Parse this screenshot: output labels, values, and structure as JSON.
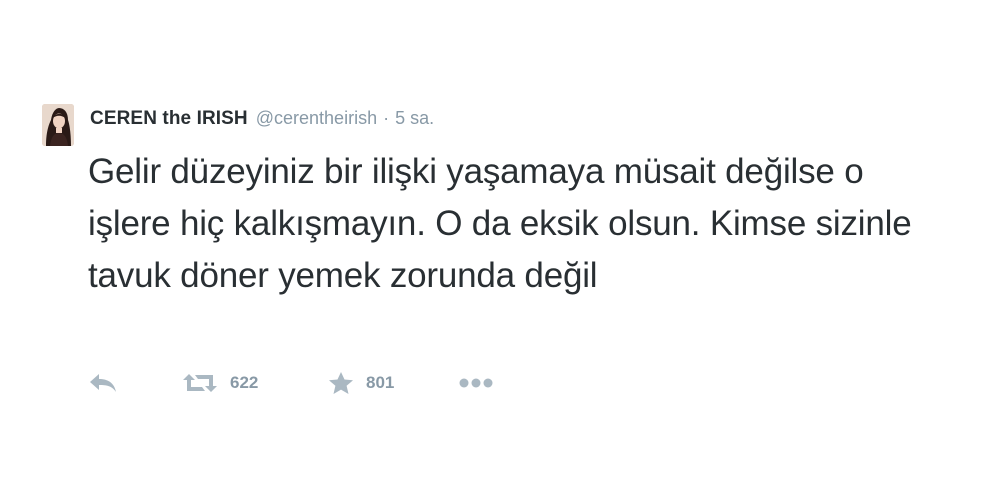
{
  "tweet": {
    "author": {
      "display_name": "CEREN the IRISH",
      "handle": "@cerentheirish",
      "avatar_icon": "profile-photo"
    },
    "separator": "·",
    "timestamp": "5 sa.",
    "text": "Gelir düzeyiniz bir ilişki yaşamaya müsait değilse o işlere hiç kalkışmayın. O da eksik olsun. Kimse sizinle tavuk döner yemek zorunda değil",
    "actions": {
      "reply_icon": "reply-icon",
      "retweet_icon": "retweet-icon",
      "retweet_count": "622",
      "favorite_icon": "star-icon",
      "favorite_count": "801",
      "more_icon": "more-dots-icon"
    }
  },
  "colors": {
    "text": "#292f33",
    "secondary_text": "#8899a6",
    "icon": "#aab8c2",
    "background": "#ffffff"
  }
}
